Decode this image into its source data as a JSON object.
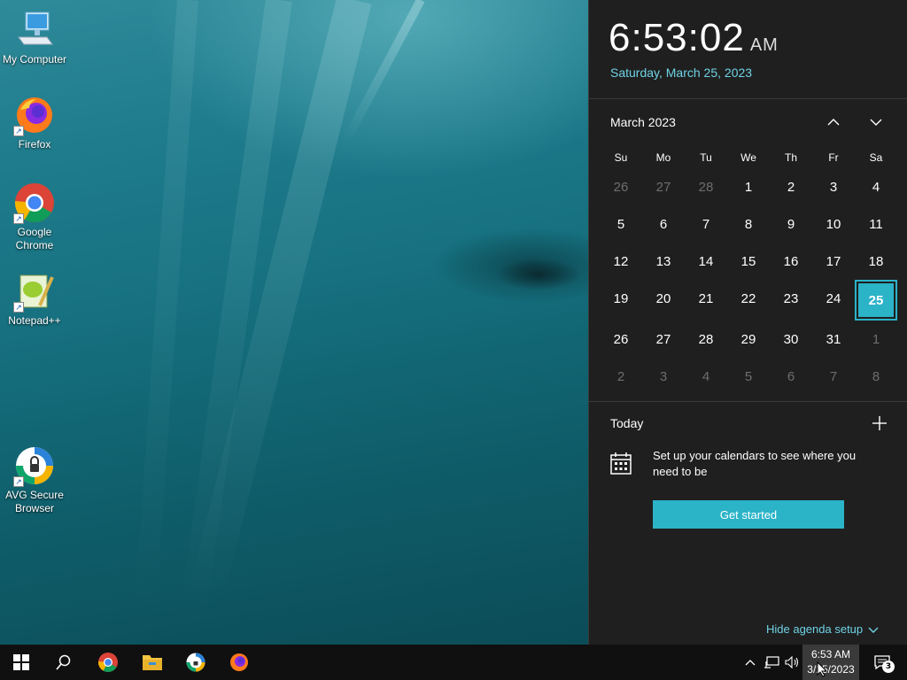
{
  "desktop": {
    "icons": [
      {
        "label": "My Computer",
        "icon": "computer-icon"
      },
      {
        "label": "Firefox",
        "icon": "firefox-icon"
      },
      {
        "label": "Google Chrome",
        "icon": "chrome-icon"
      },
      {
        "label": "Notepad++",
        "icon": "notepadpp-icon"
      },
      {
        "label": "AVG Secure Browser",
        "icon": "avg-browser-icon"
      }
    ]
  },
  "flyout": {
    "time": "6:53:02",
    "ampm": "AM",
    "date": "Saturday, March 25, 2023",
    "month_label": "March 2023",
    "weekdays": [
      "Su",
      "Mo",
      "Tu",
      "We",
      "Th",
      "Fr",
      "Sa"
    ],
    "days": [
      {
        "d": "26",
        "muted": true
      },
      {
        "d": "27",
        "muted": true
      },
      {
        "d": "28",
        "muted": true
      },
      {
        "d": "1"
      },
      {
        "d": "2"
      },
      {
        "d": "3"
      },
      {
        "d": "4"
      },
      {
        "d": "5"
      },
      {
        "d": "6"
      },
      {
        "d": "7"
      },
      {
        "d": "8"
      },
      {
        "d": "9"
      },
      {
        "d": "10"
      },
      {
        "d": "11"
      },
      {
        "d": "12"
      },
      {
        "d": "13"
      },
      {
        "d": "14"
      },
      {
        "d": "15"
      },
      {
        "d": "16"
      },
      {
        "d": "17"
      },
      {
        "d": "18"
      },
      {
        "d": "19"
      },
      {
        "d": "20"
      },
      {
        "d": "21"
      },
      {
        "d": "22"
      },
      {
        "d": "23"
      },
      {
        "d": "24"
      },
      {
        "d": "25",
        "today": true
      },
      {
        "d": "26"
      },
      {
        "d": "27"
      },
      {
        "d": "28"
      },
      {
        "d": "29"
      },
      {
        "d": "30"
      },
      {
        "d": "31"
      },
      {
        "d": "1",
        "muted": true
      },
      {
        "d": "2",
        "muted": true
      },
      {
        "d": "3",
        "muted": true
      },
      {
        "d": "4",
        "muted": true
      },
      {
        "d": "5",
        "muted": true
      },
      {
        "d": "6",
        "muted": true
      },
      {
        "d": "7",
        "muted": true
      },
      {
        "d": "8",
        "muted": true
      }
    ],
    "today_label": "Today",
    "agenda_message": "Set up your calendars to see where you need to be",
    "get_started": "Get started",
    "hide_agenda": "Hide agenda setup"
  },
  "taskbar": {
    "pinned": [
      "windows-start-icon",
      "search-icon",
      "chrome-icon",
      "file-explorer-icon",
      "avg-browser-icon",
      "firefox-icon"
    ],
    "tray_time": "6:53 AM",
    "tray_date": "3/25/2023",
    "notification_count": "3"
  },
  "colors": {
    "accent": "#2bb3c8",
    "flyout_bg": "#1f1f1f",
    "taskbar_bg": "#101010",
    "date_text": "#6fd3e6"
  }
}
